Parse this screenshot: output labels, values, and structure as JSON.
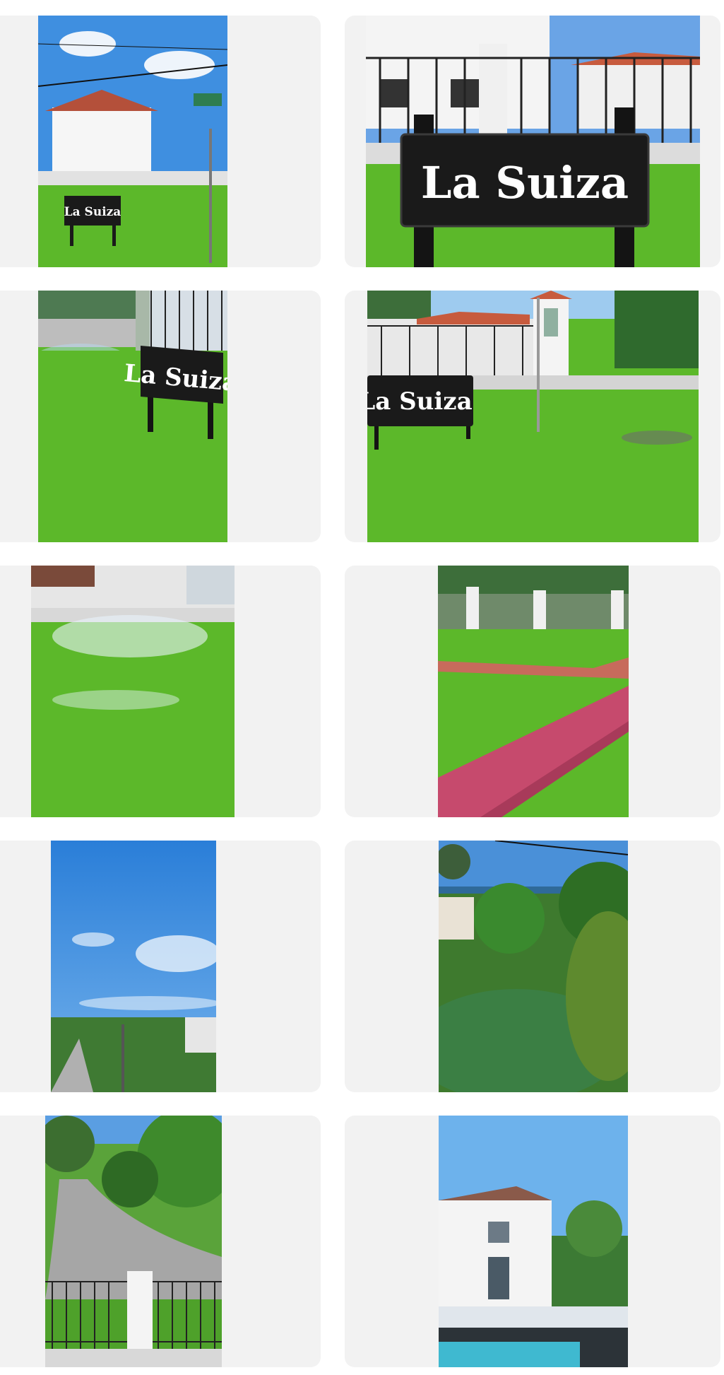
{
  "gallery": {
    "photos": [
      {
        "alt": "Street corner with La Suiza sign and white house",
        "sign_text": "La Suiza"
      },
      {
        "alt": "Close-up of La Suiza sign in front of white house",
        "sign_text": "La Suiza"
      },
      {
        "alt": "La Suiza sign on lawn with sprinkler",
        "sign_text": "La Suiza"
      },
      {
        "alt": "La Suiza sign by the entrance gate",
        "sign_text": "La Suiza"
      },
      {
        "alt": "Sprinklers watering green lawn",
        "sign_text": ""
      },
      {
        "alt": "Red brick path across the lawn",
        "sign_text": ""
      },
      {
        "alt": "Blue sky over the street",
        "sign_text": ""
      },
      {
        "alt": "Garden trees with sea view",
        "sign_text": ""
      },
      {
        "alt": "Street and fence with trees",
        "sign_text": ""
      },
      {
        "alt": "White house with swimming pool",
        "sign_text": ""
      }
    ]
  },
  "colors": {
    "tile_bg": "#f2f2f2",
    "grass": "#5cb82a",
    "sky": "#3f8fe0",
    "sign": "#1a1a1a"
  }
}
